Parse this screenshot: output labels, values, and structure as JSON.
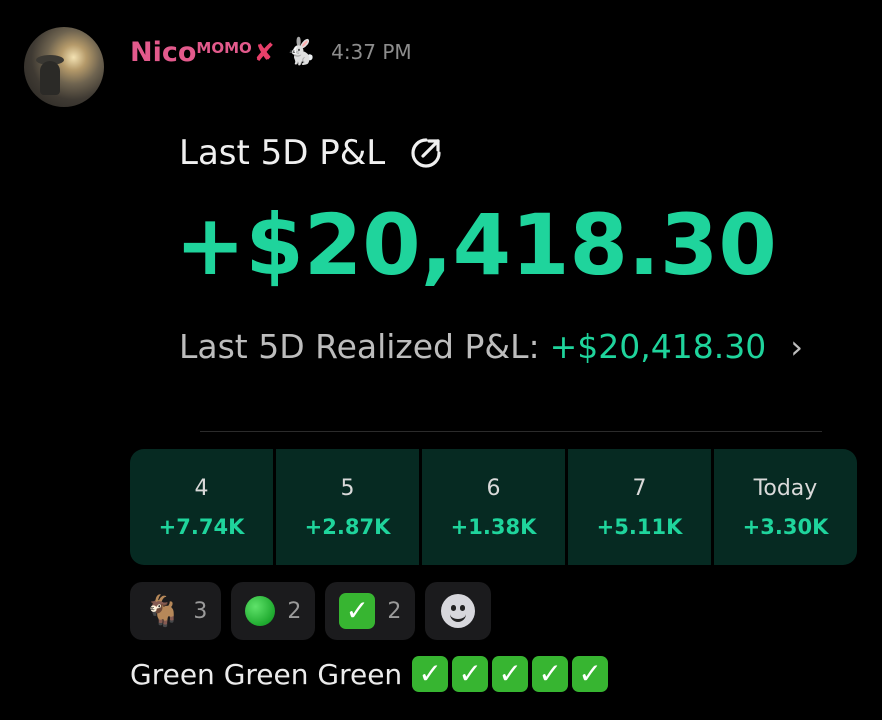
{
  "message": {
    "username": "Nico",
    "username_sup": "MOMO",
    "username_x": "✘",
    "rabbit": "🐇",
    "time": "4:37 PM",
    "text": "Green Green Green",
    "checkmarks": [
      "✓",
      "✓",
      "✓",
      "✓",
      "✓"
    ]
  },
  "card": {
    "title": "Last 5D P&L",
    "share_icon": "share-icon",
    "total": "+$20,418.30",
    "realized_label": "Last 5D Realized P&L:",
    "realized_value": "+$20,418.30",
    "chevron": "›",
    "days": [
      {
        "label": "4",
        "pnl": "+7.74K"
      },
      {
        "label": "5",
        "pnl": "+2.87K"
      },
      {
        "label": "6",
        "pnl": "+1.38K"
      },
      {
        "label": "7",
        "pnl": "+5.11K"
      },
      {
        "label": "Today",
        "pnl": "+3.30K"
      }
    ],
    "accent_color": "#1fd49c"
  },
  "reactions": [
    {
      "icon": "goat-emoji",
      "glyph": "🐐",
      "count": "3"
    },
    {
      "icon": "green-circle-emoji",
      "glyph": "",
      "count": "2"
    },
    {
      "icon": "check-mark-emoji",
      "glyph": "✓",
      "count": "2"
    }
  ],
  "add_reaction_icon": "smiley-icon"
}
